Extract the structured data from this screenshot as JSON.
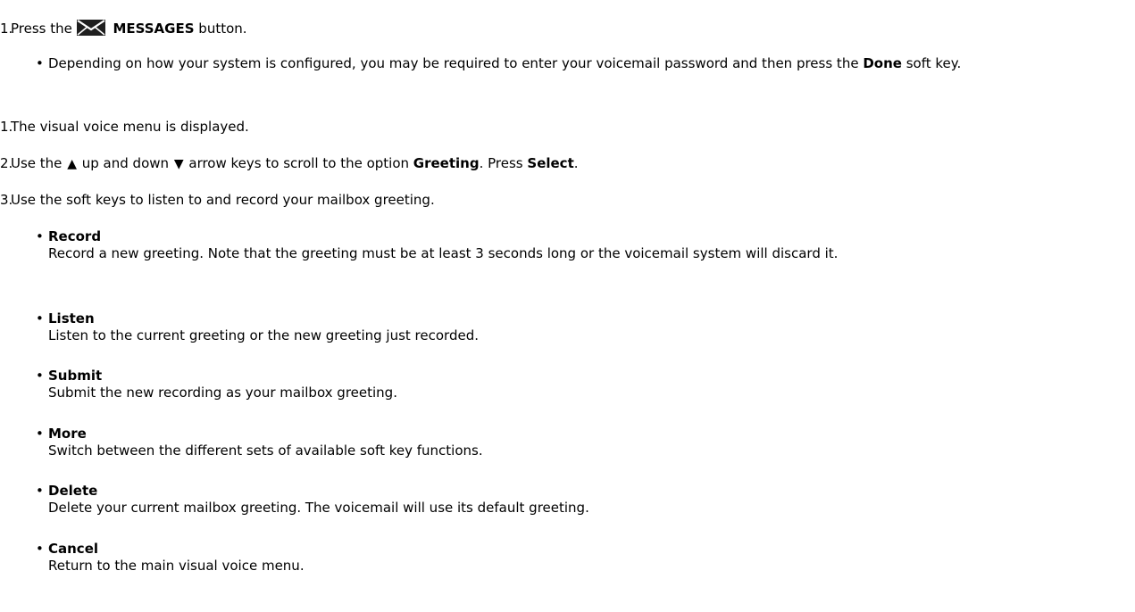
{
  "steps": [
    {
      "number": "1.",
      "pre": "Press the",
      "icon": "envelope-icon",
      "bold": "MESSAGES",
      "post": "button."
    },
    {
      "bullet": {
        "pre": "Depending on how your system is configured, you may be required to enter your voicemail password and then press the",
        "bold": "Done",
        "post": "soft key."
      }
    },
    {
      "number": "1.",
      "text": "The visual voice menu is displayed."
    },
    {
      "number": "2.",
      "pre": "Use the",
      "up_arrow": "▲",
      "mid": "up and down",
      "down_arrow": "▼",
      "mid2": "arrow keys to scroll to the option",
      "bold1": "Greeting",
      "mid3": ". Press",
      "bold2": "Select",
      "end": "."
    },
    {
      "number": "3.",
      "text": "Use the soft keys to listen to and record your mailbox greeting."
    }
  ],
  "softkeys": [
    {
      "name": "Record",
      "desc": "Record a new greeting. Note that the greeting must be at least 3 seconds long or the voicemail system will discard it."
    },
    {
      "name": "Listen",
      "desc": "Listen to the current greeting or the new greeting just recorded."
    },
    {
      "name": "Submit",
      "desc": "Submit the new recording as your mailbox greeting."
    },
    {
      "name": "More",
      "desc": "Switch between the different sets of available soft key functions."
    },
    {
      "name": "Delete",
      "desc": "Delete your current mailbox greeting. The voicemail will use its default greeting."
    },
    {
      "name": "Cancel",
      "desc": "Return to the main visual voice menu."
    }
  ]
}
